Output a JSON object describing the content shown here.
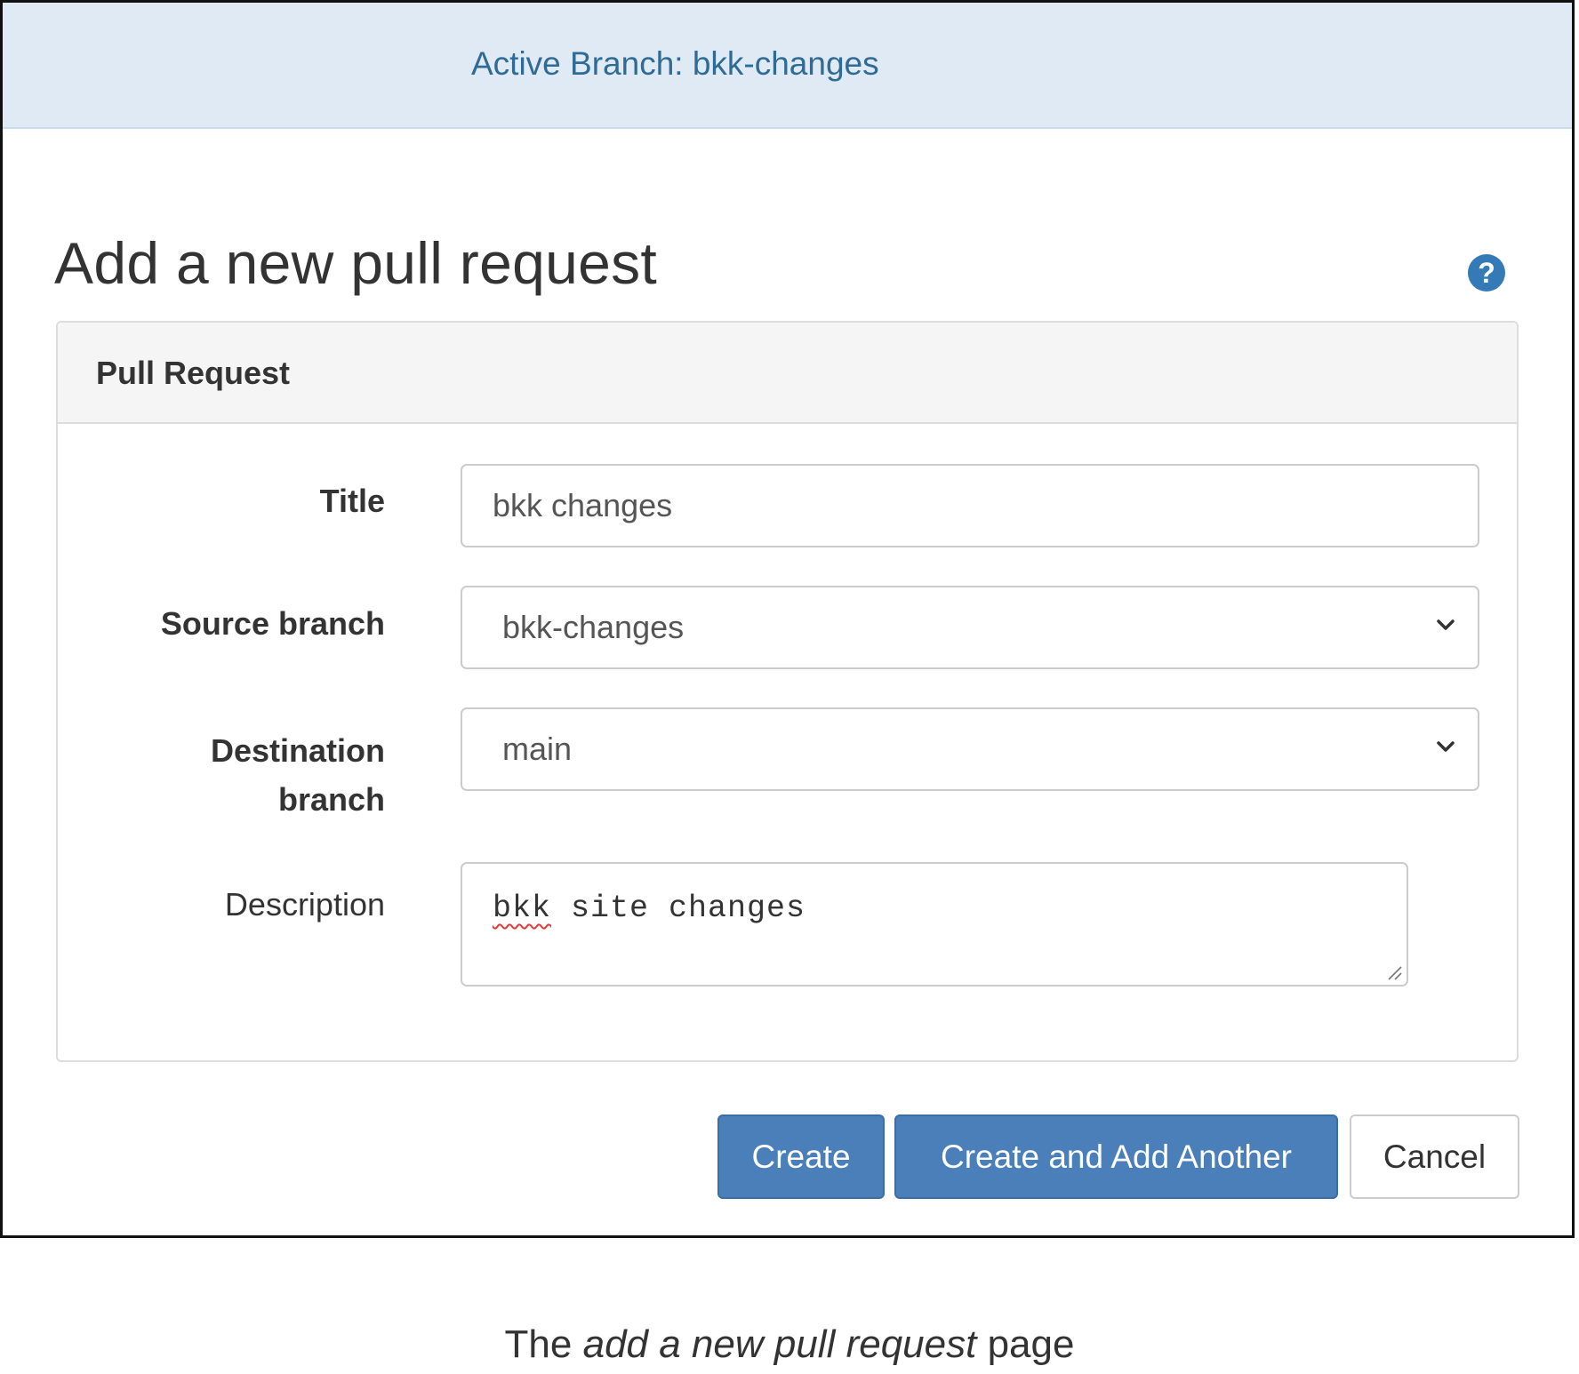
{
  "banner": {
    "text": "Active Branch: bkk-changes"
  },
  "page": {
    "title": "Add a new pull request",
    "help_icon": "question-circle-icon"
  },
  "panel": {
    "heading": "Pull Request",
    "fields": {
      "title": {
        "label": "Title",
        "value": "bkk changes"
      },
      "source_branch": {
        "label": "Source branch",
        "selected": "bkk-changes"
      },
      "destination_branch": {
        "label_line1": "Destination",
        "label_line2": "branch",
        "selected": "main"
      },
      "description": {
        "label": "Description",
        "value_misspelled": "bkk",
        "value_rest": " site changes"
      }
    }
  },
  "buttons": {
    "create": "Create",
    "create_and_add": "Create and Add Another",
    "cancel": "Cancel"
  },
  "caption": {
    "prefix": "The ",
    "emphasis": "add a new pull request",
    "suffix": " page"
  },
  "colors": {
    "banner_bg": "#dfeaf4",
    "banner_text": "#2f6b94",
    "primary": "#4a7fba",
    "help_icon": "#337ab7",
    "spell_error": "#e33b3b"
  }
}
